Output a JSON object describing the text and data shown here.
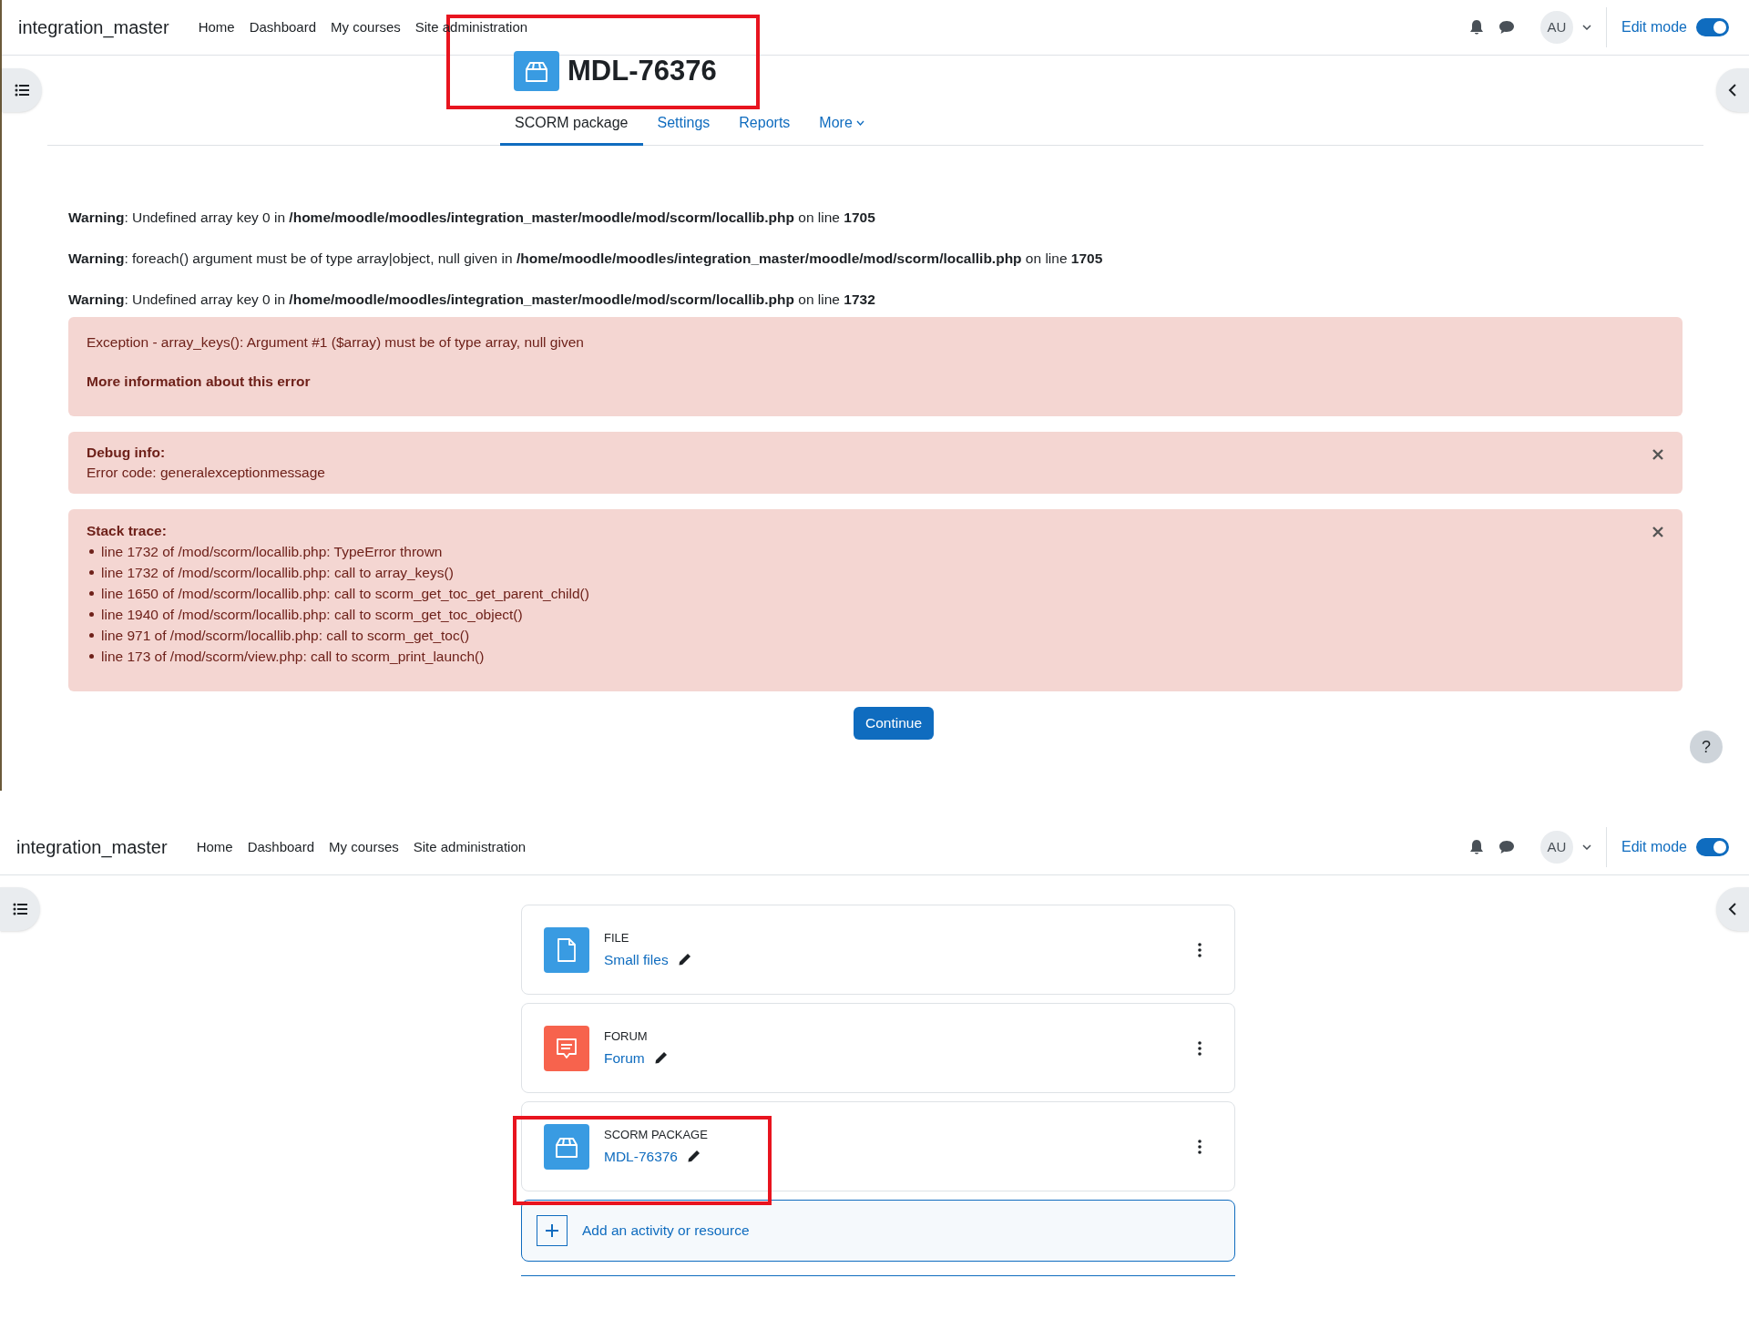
{
  "error_page": {
    "navbar": {
      "brand": "integration_master",
      "links": [
        "Home",
        "Dashboard",
        "My courses",
        "Site administration"
      ],
      "avatar": "AU",
      "edit_mode": {
        "label": "Edit mode",
        "on": true
      }
    },
    "title": "MDL-76376",
    "tabs": [
      {
        "label": "SCORM package",
        "selected": true
      },
      {
        "label": "Settings",
        "selected": false
      },
      {
        "label": "Reports",
        "selected": false
      },
      {
        "label": "More",
        "selected": false
      }
    ],
    "warnings": [
      "**Warning**: Undefined array key 0 in **/home/moodle/moodles/integration_master/moodle/mod/scorm/locallib.php** on line **1705**",
      "**Warning**: foreach() argument must be of type array|object, null given in **/home/moodle/moodles/integration_master/moodle/mod/scorm/locallib.php** on line **1705**",
      "**Warning**: Undefined array key 0 in **/home/moodle/moodles/integration_master/moodle/mod/scorm/locallib.php** on line **1732**"
    ],
    "exception": {
      "message": "Exception - array_keys(): Argument #1 ($array) must be of type array, null given",
      "more_info": "More information about this error"
    },
    "debug": {
      "heading": "Debug info:",
      "text": "Error code: generalexceptionmessage"
    },
    "stack": {
      "heading": "Stack trace:",
      "lines": [
        "line 1732 of /mod/scorm/locallib.php: TypeError thrown",
        "line 1732 of /mod/scorm/locallib.php: call to array_keys()",
        "line 1650 of /mod/scorm/locallib.php: call to scorm_get_toc_get_parent_child()",
        "line 1940 of /mod/scorm/locallib.php: call to scorm_get_toc_object()",
        "line 971 of /mod/scorm/locallib.php: call to scorm_get_toc()",
        "line 173 of /mod/scorm/view.php: call to scorm_print_launch()"
      ]
    },
    "continue": "Continue",
    "help": "?"
  },
  "course_page": {
    "navbar": {
      "brand": "integration_master",
      "links": [
        "Home",
        "Dashboard",
        "My courses",
        "Site administration"
      ],
      "avatar": "AU",
      "edit_mode": {
        "label": "Edit mode",
        "on": true
      }
    },
    "activities": [
      {
        "kind": "file",
        "type": "FILE",
        "name": "Small files"
      },
      {
        "kind": "forum",
        "type": "FORUM",
        "name": "Forum"
      },
      {
        "kind": "scorm",
        "type": "SCORM PACKAGE",
        "name": "MDL-76376"
      }
    ],
    "add_activity": "Add an activity or resource"
  }
}
